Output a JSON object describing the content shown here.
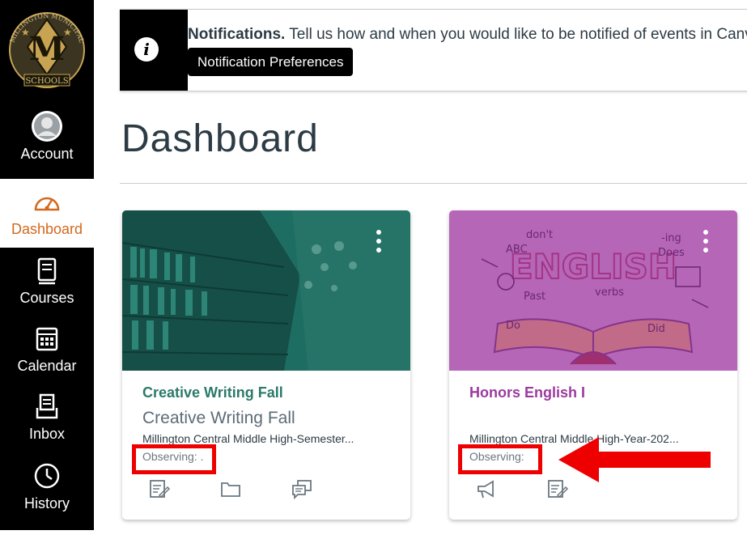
{
  "nav": {
    "logo": {
      "text_top": "MILLINGTON MUNICIPAL",
      "letter": "M",
      "text_bottom": "SCHOOLS"
    },
    "items": [
      {
        "label": "Account",
        "icon": "avatar-icon",
        "active": false
      },
      {
        "label": "Dashboard",
        "icon": "dashboard-icon",
        "active": true
      },
      {
        "label": "Courses",
        "icon": "courses-icon",
        "active": false
      },
      {
        "label": "Calendar",
        "icon": "calendar-icon",
        "active": false
      },
      {
        "label": "Inbox",
        "icon": "inbox-icon",
        "active": false
      },
      {
        "label": "History",
        "icon": "history-icon",
        "active": false
      }
    ]
  },
  "notification": {
    "title": "Notifications.",
    "message": "Tell us how and when you would like to be notified of events in Canvas.",
    "button_label": "Notification Preferences"
  },
  "page": {
    "title": "Dashboard"
  },
  "cards": [
    {
      "link_title": "Creative Writing Fall",
      "subtitle": "Creative Writing Fall",
      "term": "Millington Central Middle High-Semester...",
      "observing": "Observing: .",
      "color": "#2b7a6b",
      "actions": [
        "assignments-icon",
        "files-icon",
        "discussions-icon"
      ]
    },
    {
      "link_title": "Honors English I",
      "subtitle": "",
      "term": "Millington Central Middle High-Year-202...",
      "observing": "Observing:",
      "color": "#b248b5",
      "actions": [
        "announcements-icon",
        "assignments-icon"
      ]
    }
  ],
  "english_art": {
    "word": "ENGLISH",
    "words": [
      "ABC",
      "don't",
      "Does",
      "-ing",
      "Past",
      "verbs",
      "Did",
      "Do"
    ]
  },
  "colors": {
    "nav_bg": "#000000",
    "accent": "#d2691e",
    "annotation": "#ee0000"
  }
}
